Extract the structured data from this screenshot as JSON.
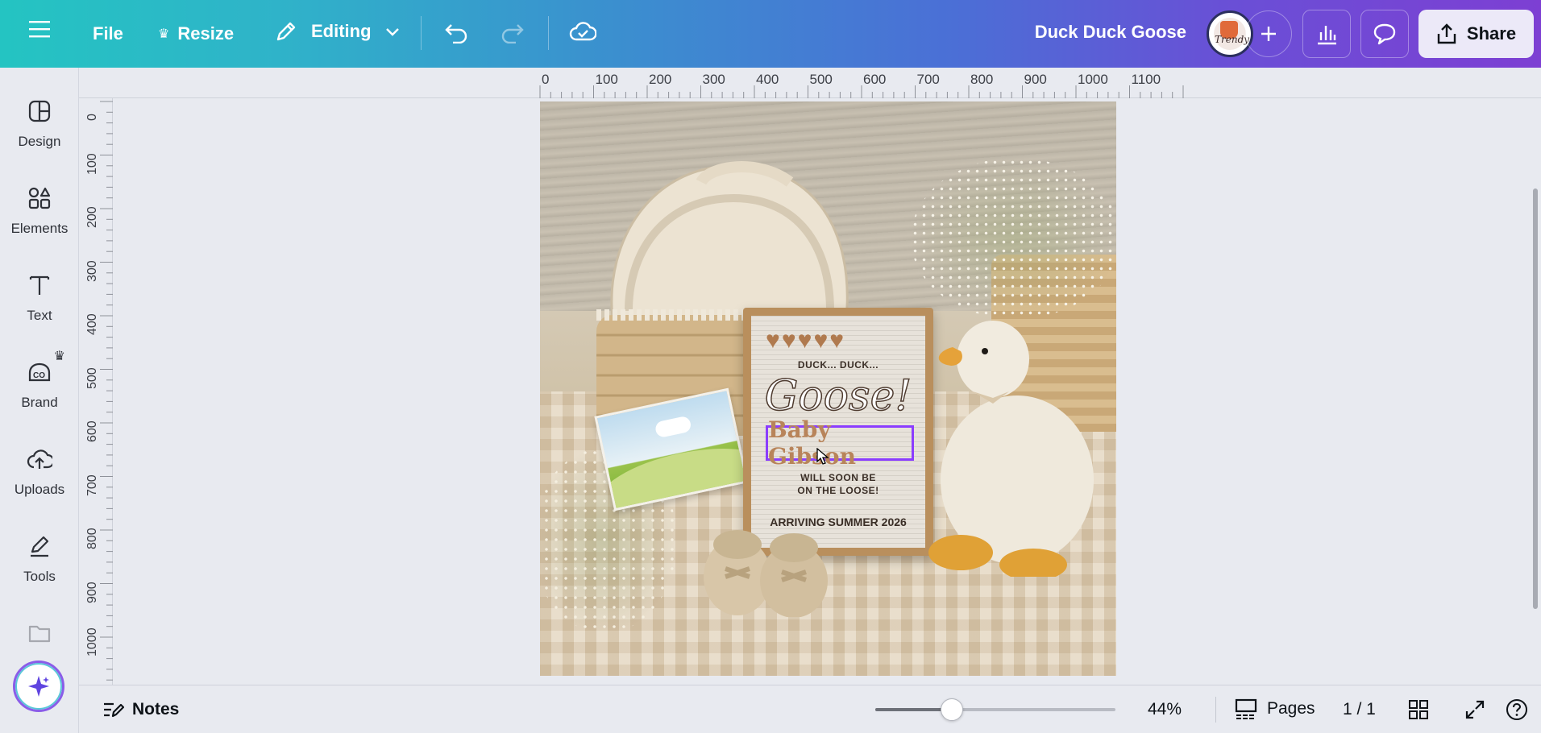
{
  "topbar": {
    "file_label": "File",
    "resize_label": "Resize",
    "editing_label": "Editing",
    "design_title": "Duck Duck Goose",
    "share_label": "Share",
    "avatar_text": "Trendy"
  },
  "sidebar": {
    "items": [
      {
        "label": "Design",
        "icon": "design-icon"
      },
      {
        "label": "Elements",
        "icon": "elements-icon"
      },
      {
        "label": "Text",
        "icon": "text-icon"
      },
      {
        "label": "Brand",
        "icon": "brand-icon"
      },
      {
        "label": "Uploads",
        "icon": "uploads-icon"
      },
      {
        "label": "Tools",
        "icon": "tools-icon"
      }
    ]
  },
  "ruler": {
    "top": [
      "0",
      "100",
      "200",
      "300",
      "400",
      "500",
      "600",
      "700",
      "800",
      "900",
      "1000",
      "1100"
    ],
    "left": [
      "0",
      "100",
      "200",
      "300",
      "400",
      "500",
      "600",
      "700",
      "800",
      "900",
      "1000"
    ]
  },
  "design": {
    "board_line1": "DUCK... DUCK...",
    "board_goose": "Goose!",
    "board_name": "Baby Gibson",
    "board_line2": "WILL SOON BE",
    "board_line3": "ON THE LOOSE!",
    "board_arriving": "ARRIVING SUMMER 2026",
    "hearts": "♥♥♥♥♥"
  },
  "bottombar": {
    "notes_label": "Notes",
    "zoom_label": "44%",
    "zoom_fraction": 0.32,
    "pages_label": "Pages",
    "page_count": "1 / 1"
  },
  "colors": {
    "accent_purple": "#8b3dff",
    "gradient_start": "#24c4c2",
    "gradient_end": "#7d3fd3"
  }
}
